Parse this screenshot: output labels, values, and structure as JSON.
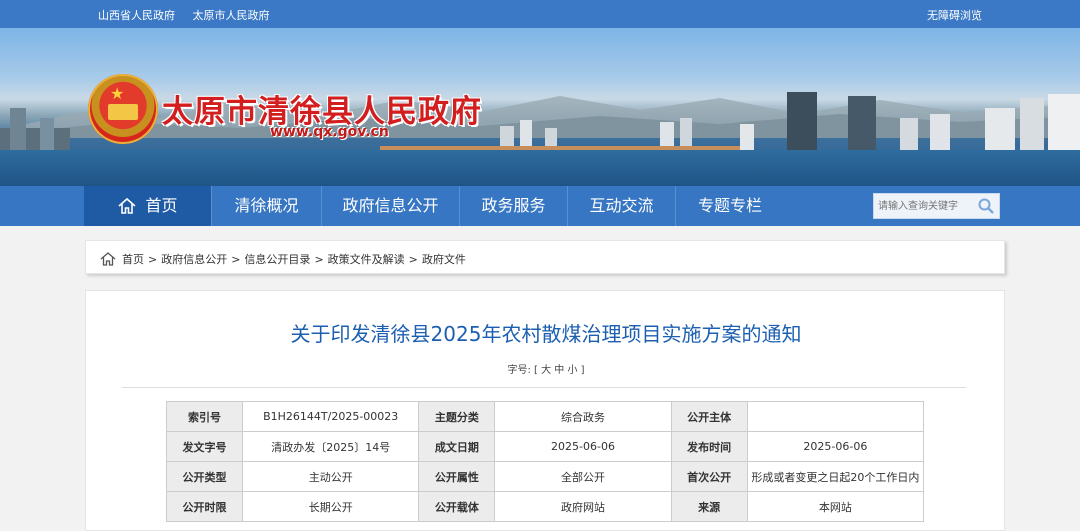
{
  "topbar": {
    "links": [
      "山西省人民政府",
      "太原市人民政府"
    ],
    "accessibility": "无障碍浏览"
  },
  "header": {
    "title": "太原市清徐县人民政府",
    "url": "www.qx.gov.cn"
  },
  "nav": {
    "home": "首页",
    "items": [
      "清徐概况",
      "政府信息公开",
      "政务服务",
      "互动交流",
      "专题专栏"
    ]
  },
  "search": {
    "placeholder": "请输入查询关键字"
  },
  "breadcrumb": [
    "首页",
    "政府信息公开",
    "信息公开目录",
    "政策文件及解读",
    "政府文件"
  ],
  "document": {
    "title": "关于印发清徐县2025年农村散煤治理项目实施方案的通知",
    "font_size_label": "字号:",
    "font_sizes": "[ 大 中 小 ]"
  },
  "meta_table": {
    "rows": [
      [
        {
          "k": "索引号",
          "v": "B1H26144T/2025-00023"
        },
        {
          "k": "主题分类",
          "v": "综合政务"
        },
        {
          "k": "公开主体",
          "v": ""
        }
      ],
      [
        {
          "k": "发文字号",
          "v": "清政办发〔2025〕14号"
        },
        {
          "k": "成文日期",
          "v": "2025-06-06"
        },
        {
          "k": "发布时间",
          "v": "2025-06-06"
        }
      ],
      [
        {
          "k": "公开类型",
          "v": "主动公开"
        },
        {
          "k": "公开属性",
          "v": "全部公开"
        },
        {
          "k": "首次公开",
          "v": "形成或者变更之日起20个工作日内"
        }
      ],
      [
        {
          "k": "公开时限",
          "v": "长期公开"
        },
        {
          "k": "公开载体",
          "v": "政府网站"
        },
        {
          "k": "来源",
          "v": "本网站"
        }
      ]
    ]
  },
  "colors": {
    "primary": "#3676c3",
    "title_red": "#d21e1e",
    "doc_title": "#1c5fb1"
  },
  "icons": [
    "home-icon",
    "search-icon",
    "national-emblem"
  ]
}
